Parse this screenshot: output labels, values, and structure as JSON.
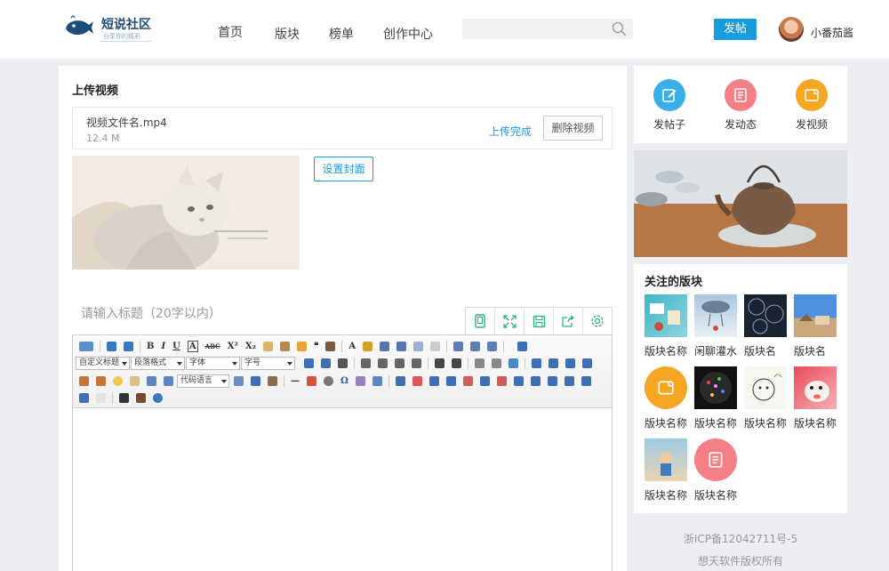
{
  "header": {
    "logo_title": "短说社区",
    "logo_subtitle": "分享你的精彩",
    "nav": [
      "首页",
      "版块",
      "榜单",
      "创作中心"
    ],
    "search_placeholder": "",
    "post_button": "发帖",
    "username": "小番茄酱"
  },
  "upload": {
    "section_title": "上传视频",
    "file_name": "视频文件名.mp4",
    "file_size": "12.4 M",
    "status": "上传完成",
    "delete_button": "删除视频",
    "cover_button": "设置封面"
  },
  "post": {
    "title_placeholder": "请输入标题（20字以内）"
  },
  "editor": {
    "row1_text": [
      "B",
      "I",
      "U",
      "A",
      "ABC",
      "X²",
      "X₂",
      "A"
    ],
    "selects": [
      "自定义标题",
      "段落格式",
      "字体",
      "字号",
      "代码语言"
    ]
  },
  "sidebar": {
    "actions": [
      "发帖子",
      "发动态",
      "发视频"
    ],
    "action_colors": [
      "#3aaee8",
      "#f47f86",
      "#f5a623"
    ],
    "follow_title": "关注的版块",
    "boards": [
      "版块名称",
      "闲聊灌水",
      "版块名",
      "版块名",
      "版块名称",
      "版块名称",
      "版块名称",
      "版块名称",
      "版块名称",
      "版块名称"
    ]
  },
  "footer": {
    "icp": "浙ICP备12042711号-5",
    "copyright": "想天软件版权所有"
  }
}
